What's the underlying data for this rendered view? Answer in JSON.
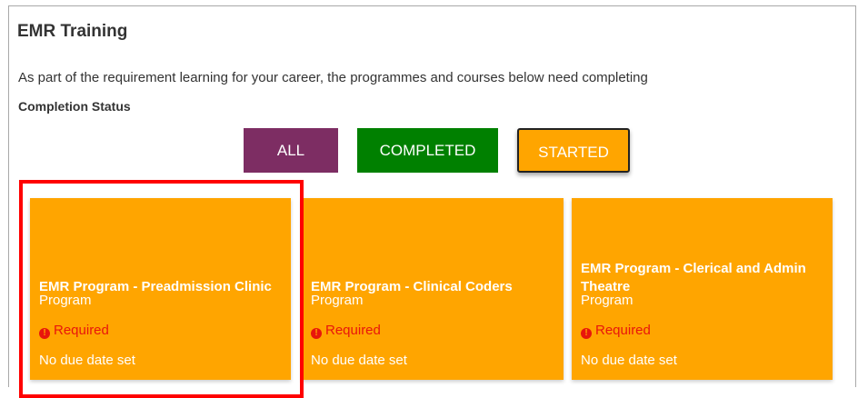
{
  "page": {
    "title": "EMR Training",
    "intro": "As part of the requirement learning for your career, the programmes and courses below need completing",
    "status_label": "Completion Status"
  },
  "filters": {
    "all": "ALL",
    "completed": "COMPLETED",
    "started": "STARTED"
  },
  "colors": {
    "all": "#7d2d63",
    "completed": "#008000",
    "started": "#ffa500",
    "required": "#e8160c",
    "highlight": "#ff0000"
  },
  "cards": [
    {
      "name": "EMR Program - Preadmission Clinic",
      "type": "Program",
      "required": "Required",
      "required_icon": "exclamation-circle-icon",
      "due": "No due date set"
    },
    {
      "name": "EMR Program - Clinical Coders",
      "type": "Program",
      "required": "Required",
      "required_icon": "exclamation-circle-icon",
      "due": "No due date set"
    },
    {
      "name": "EMR Program - Clerical and Admin Theatre",
      "type": "Program",
      "required": "Required",
      "required_icon": "exclamation-circle-icon",
      "due": "No due date set"
    }
  ]
}
